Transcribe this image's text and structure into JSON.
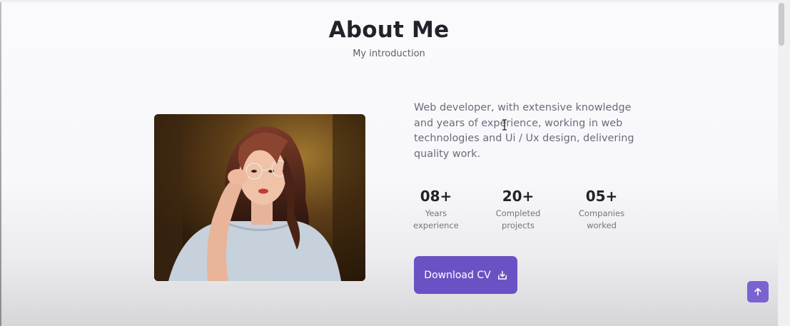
{
  "section": {
    "title": "About Me",
    "subtitle": "My introduction"
  },
  "about": {
    "image_alt": "portrait photo of a woman holding glasses",
    "description": "Web developer, with extensive knowledge and years of experience, working in web technologies and Ui / Ux design, delivering quality work.",
    "stats": [
      {
        "number": "08+",
        "label_line1": "Years",
        "label_line2": "experience"
      },
      {
        "number": "20+",
        "label_line1": "Completed",
        "label_line2": "projects"
      },
      {
        "number": "05+",
        "label_line1": "Companies",
        "label_line2": "worked"
      }
    ],
    "button_label": "Download CV",
    "button_icon": "download-icon"
  },
  "scroll_up": {
    "icon": "arrow-up-icon"
  },
  "colors": {
    "accent": "#6a52c4",
    "title": "#23222b",
    "text": "#6c6a7a"
  }
}
